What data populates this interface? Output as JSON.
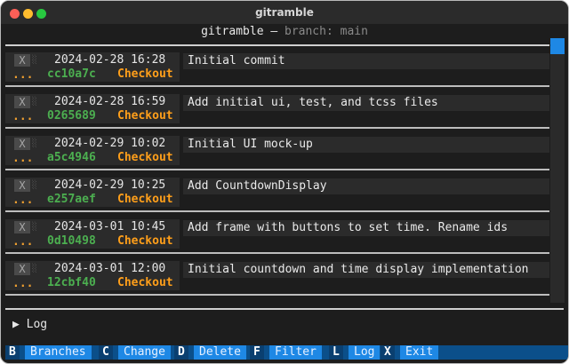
{
  "window": {
    "title": "gitramble"
  },
  "header": {
    "app": "gitramble — ",
    "branch": "branch: main"
  },
  "commits": [
    {
      "date": "2024-02-28 16:28",
      "hash": "cc10a7c",
      "message": "Initial commit"
    },
    {
      "date": "2024-02-28 16:59",
      "hash": "0265689",
      "message": "Add initial ui, test, and tcss files"
    },
    {
      "date": "2024-02-29 10:02",
      "hash": "a5c4946",
      "message": "Initial UI mock-up"
    },
    {
      "date": "2024-02-29 10:25",
      "hash": "e257aef",
      "message": "Add CountdownDisplay"
    },
    {
      "date": "2024-03-01 10:45",
      "hash": "0d10498",
      "message": "Add frame with buttons to set time. Rename ids"
    },
    {
      "date": "2024-03-01 12:00",
      "hash": "12cbf40",
      "message": "Initial countdown and time display implementation"
    }
  ],
  "row_labels": {
    "x_button": "X",
    "ellipsis": "...",
    "checkout": "Checkout",
    "hatch": "░"
  },
  "log_panel": {
    "label": "▶ Log"
  },
  "footer": {
    "keys": [
      {
        "key": "B",
        "label": "Branches"
      },
      {
        "key": "C",
        "label": "Change"
      },
      {
        "key": "D",
        "label": "Delete"
      },
      {
        "key": "F",
        "label": "Filter"
      },
      {
        "key": "L",
        "label": "Log"
      },
      {
        "key": "X",
        "label": "Exit"
      }
    ]
  },
  "colors": {
    "hash_green": "#4caf50",
    "checkout_orange": "#ff9f1a",
    "footer_blue": "#1e88e5",
    "background": "#1d1d1d"
  }
}
